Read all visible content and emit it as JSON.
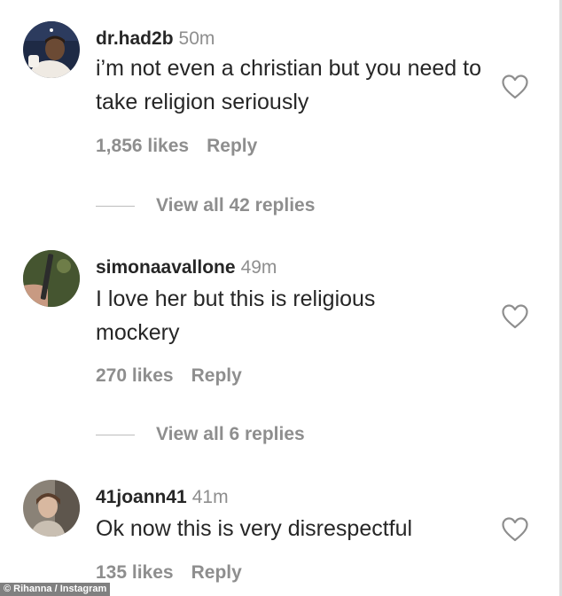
{
  "comments": [
    {
      "username": "dr.had2b",
      "time": "50m",
      "text": "i’m not even a christian but you need to take religion seriously",
      "likes": "1,856 likes",
      "reply_label": "Reply",
      "view_replies": "View all 42 replies",
      "heart_icon": "heart-outline-icon"
    },
    {
      "username": "simonaavallone",
      "time": "49m",
      "text": "I love her but this is religious mockery",
      "likes": "270 likes",
      "reply_label": "Reply",
      "view_replies": "View all 6 replies",
      "heart_icon": "heart-outline-icon"
    },
    {
      "username": "41joann41",
      "time": "41m",
      "text": "Ok now this is very disrespectful",
      "likes": "135 likes",
      "reply_label": "Reply",
      "heart_icon": "heart-outline-icon"
    }
  ],
  "credit": "© Rihanna / Instagram",
  "colors": {
    "username": "#262626",
    "secondary": "#8e8e8e",
    "divider": "#bdbdbd",
    "credit_bg": "#808080"
  }
}
